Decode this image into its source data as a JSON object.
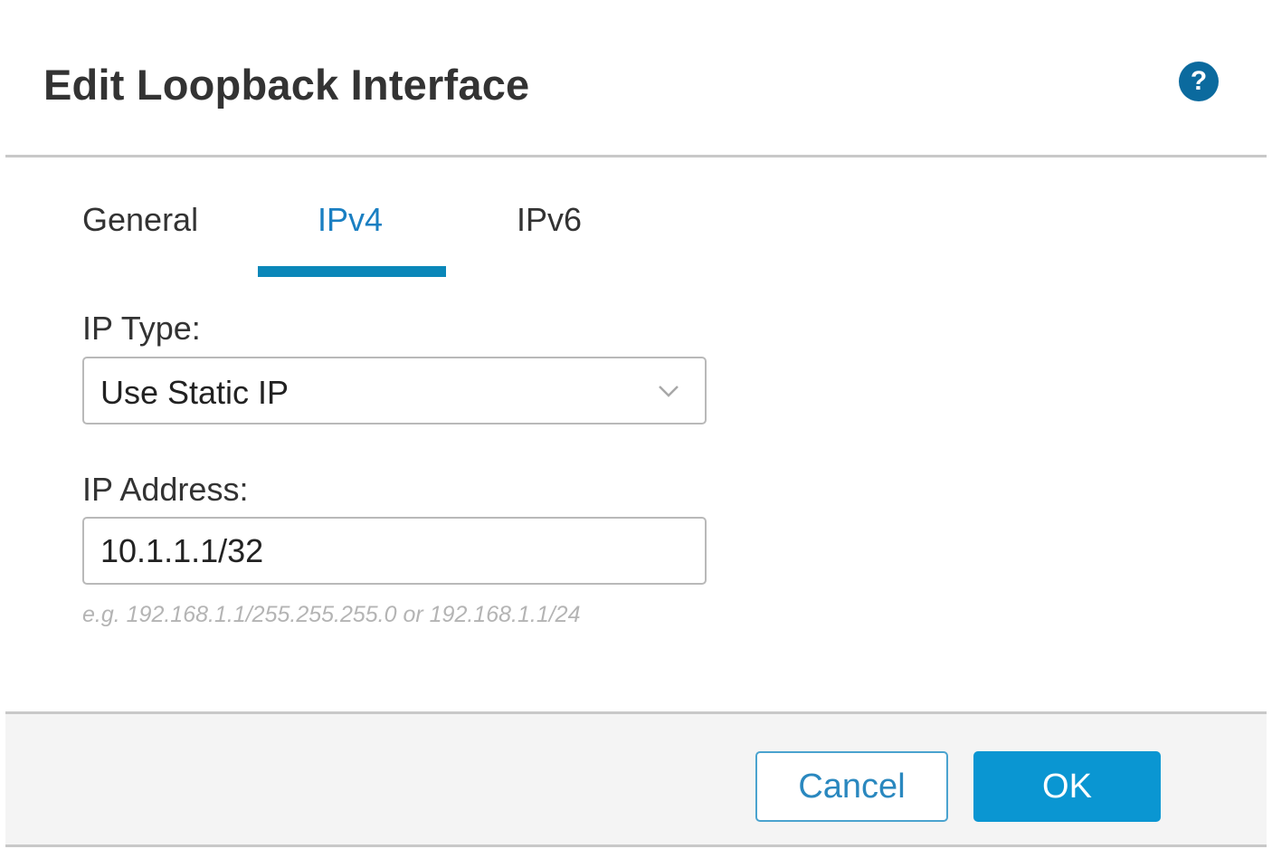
{
  "dialog": {
    "title": "Edit Loopback Interface",
    "help_icon": "?"
  },
  "tabs": [
    {
      "label": "General",
      "active": false
    },
    {
      "label": "IPv4",
      "active": true
    },
    {
      "label": "IPv6",
      "active": false
    }
  ],
  "form": {
    "ip_type_label": "IP Type:",
    "ip_type_value": "Use Static IP",
    "ip_address_label": "IP Address:",
    "ip_address_value": "10.1.1.1/32",
    "ip_address_hint": "e.g. 192.168.1.1/255.255.255.0 or 192.168.1.1/24"
  },
  "footer": {
    "cancel_label": "Cancel",
    "ok_label": "OK"
  },
  "colors": {
    "accent": "#0a87b9",
    "primary_button": "#0a96d2",
    "help_icon": "#0b6a9e"
  },
  "icons": {
    "help": "help-icon",
    "dropdown": "chevron-down-icon"
  }
}
